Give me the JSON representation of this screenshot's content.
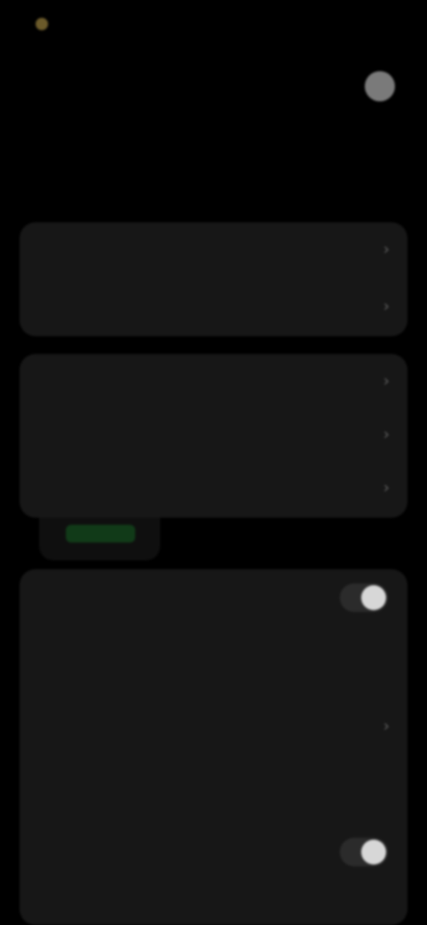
{
  "status_bar": {
    "time": "",
    "right": ""
  },
  "page": {
    "title": ""
  },
  "sections": {
    "display": "",
    "advanced": ""
  },
  "display_card": {
    "row1": "",
    "row2": ""
  },
  "preview_card": {
    "row1": "",
    "row2": "",
    "row3": ""
  },
  "advanced_card": {
    "row1": "",
    "row1_subtitle": "",
    "row2": "",
    "row2_subtitle": "",
    "row3": "",
    "row3_subtitle": ""
  },
  "icons": {
    "help": "help-icon",
    "chevron": "chevron-right-icon"
  },
  "colors": {
    "background": "#000000",
    "card": "#171717",
    "accent": "#113a18"
  }
}
